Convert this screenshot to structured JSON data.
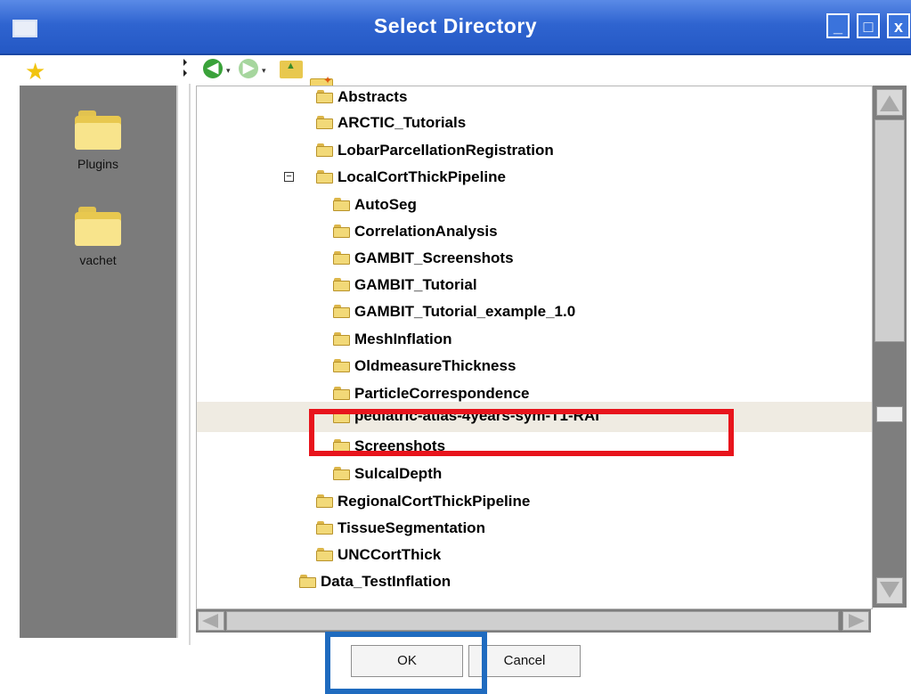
{
  "window": {
    "title": "Select Directory",
    "controls": {
      "minimize": "_",
      "maximize": "□",
      "close": "x"
    }
  },
  "sidebar": {
    "items": [
      {
        "label": "Plugins"
      },
      {
        "label": "vachet"
      }
    ]
  },
  "toolbar": {
    "back_glyph": "◀",
    "forward_glyph": "▶",
    "dropdown_glyph": "▾"
  },
  "tree": {
    "expander_glyph": "−",
    "rows": [
      {
        "label": "Abstracts"
      },
      {
        "label": "ARCTIC_Tutorials"
      },
      {
        "label": "LobarParcellationRegistration"
      },
      {
        "label": "LocalCortThickPipeline",
        "expanded": true
      },
      {
        "label": "AutoSeg"
      },
      {
        "label": "CorrelationAnalysis"
      },
      {
        "label": "GAMBIT_Screenshots"
      },
      {
        "label": "GAMBIT_Tutorial"
      },
      {
        "label": "GAMBIT_Tutorial_example_1.0"
      },
      {
        "label": "MeshInflation"
      },
      {
        "label": "OldmeasureThickness"
      },
      {
        "label": "ParticleCorrespondence"
      },
      {
        "label": "pediatric-atlas-4years-sym-T1-RAI",
        "selected": true
      },
      {
        "label": "Screenshots"
      },
      {
        "label": "SulcalDepth"
      },
      {
        "label": "RegionalCortThickPipeline"
      },
      {
        "label": "TissueSegmentation"
      },
      {
        "label": "UNCCortThick"
      },
      {
        "label": "Data_TestInflation"
      }
    ]
  },
  "buttons": {
    "ok_label": "OK",
    "cancel_label": "Cancel"
  },
  "colors": {
    "title_bar": "#2f64d0",
    "selection": "#efebe2",
    "highlight_red": "#e8141c",
    "highlight_blue": "#1f6bbf"
  }
}
